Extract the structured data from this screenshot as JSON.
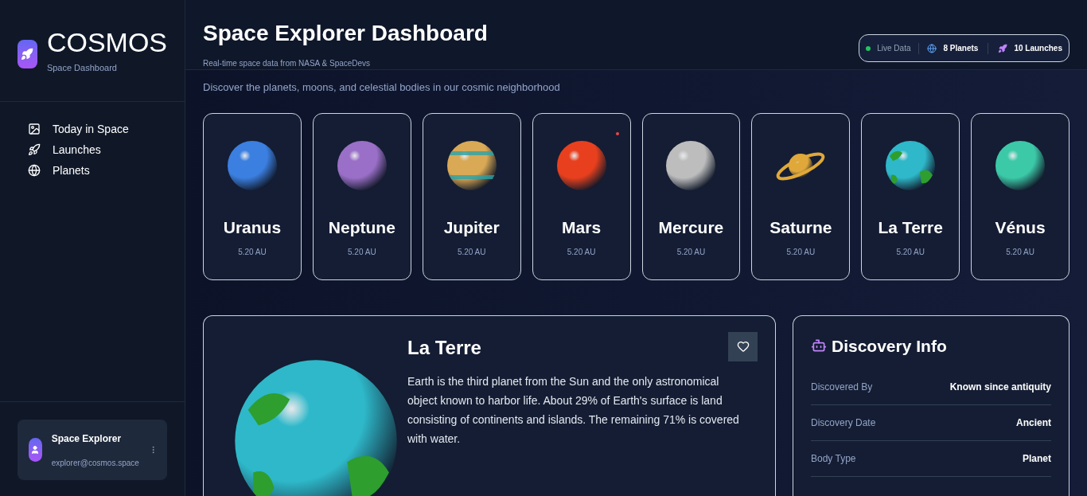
{
  "brand": {
    "name": "COSMOS",
    "subtitle": "Space Dashboard"
  },
  "nav": [
    {
      "label": "Today in Space"
    },
    {
      "label": "Launches"
    },
    {
      "label": "Planets"
    }
  ],
  "user": {
    "name": "Space Explorer",
    "email": "explorer@cosmos.space"
  },
  "header": {
    "title": "Space Explorer Dashboard",
    "subtitle": "Real-time space data from NASA & SpaceDevs",
    "live": "Live Data",
    "planets": "8 Planets",
    "launches": "10 Launches"
  },
  "section": {
    "subtitle": "Discover the planets, moons, and celestial bodies in our cosmic neighborhood"
  },
  "planets": [
    {
      "name": "Uranus",
      "distance": "5.20 AU",
      "kind": "sphere",
      "color": "#3b7fe0",
      "dot": false
    },
    {
      "name": "Neptune",
      "distance": "5.20 AU",
      "kind": "sphere",
      "color": "#9a6fc7",
      "dot": false
    },
    {
      "name": "Jupiter",
      "distance": "5.20 AU",
      "kind": "banded",
      "color": "#d9a956",
      "dot": false
    },
    {
      "name": "Mars",
      "distance": "5.20 AU",
      "kind": "sphere",
      "color": "#e8401e",
      "dot": true
    },
    {
      "name": "Mercure",
      "distance": "5.20 AU",
      "kind": "sphere",
      "color": "#bdbdbd",
      "dot": false
    },
    {
      "name": "Saturne",
      "distance": "5.20 AU",
      "kind": "ringed",
      "color": "#e0a83a",
      "dot": false
    },
    {
      "name": "La Terre",
      "distance": "5.20 AU",
      "kind": "earth",
      "color": "#2eb8c9",
      "dot": false
    },
    {
      "name": "Vénus",
      "distance": "5.20 AU",
      "kind": "sphere",
      "color": "#3cc9a8",
      "dot": false
    }
  ],
  "detail": {
    "title": "La Terre",
    "description": "Earth is the third planet from the Sun and the only astronomical object known to harbor life. About 29% of Earth's surface is land consisting of continents and islands. The remaining 71% is covered with water."
  },
  "discovery": {
    "title": "Discovery Info",
    "rows": [
      {
        "label": "Discovered By",
        "value": "Known since antiquity"
      },
      {
        "label": "Discovery Date",
        "value": "Ancient"
      },
      {
        "label": "Body Type",
        "value": "Planet"
      }
    ]
  }
}
